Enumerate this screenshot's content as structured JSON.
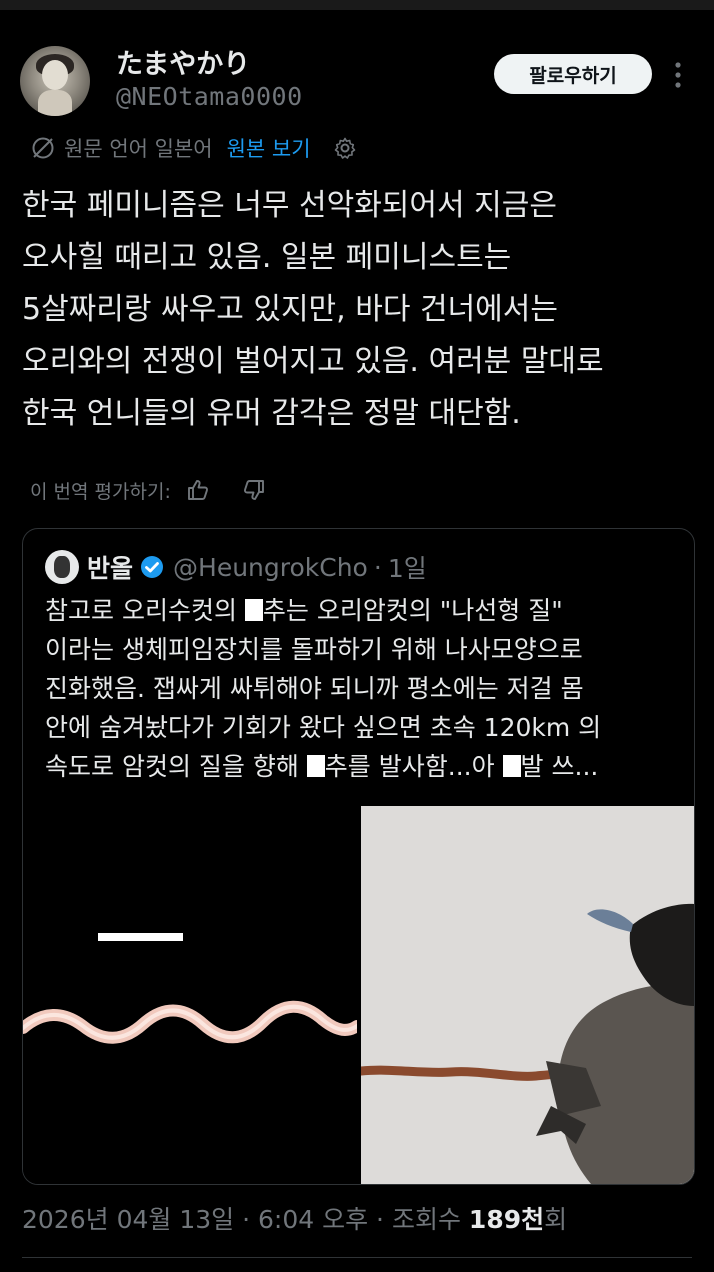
{
  "author": {
    "display_name": "たまやかり",
    "handle": "@NEOtama0000"
  },
  "actions": {
    "follow_label": "팔로우하기",
    "more_icon": "more-vertical-icon"
  },
  "translation": {
    "original_language_label": "원문 언어 일본어",
    "view_original_label": "원본 보기",
    "rate_label": "이 번역 평가하기:"
  },
  "tweet": {
    "text": "한국 페미니즘은 너무 선악화되어서 지금은\n오사힐 때리고 있음. 일본 페미니스트는\n5살짜리랑 싸우고 있지만, 바다 건너에서는\n오리와의 전쟁이 벌어지고 있음. 여러분 말대로\n한국 언니들의 유머 감각은 정말 대단함."
  },
  "quote": {
    "name": "반올",
    "handle": "@HeungrokCho",
    "separator": "·",
    "time": "1일",
    "text_line1_a": "참고로 오리수컷의 ",
    "text_line1_b": "추는 오리암컷의 \"나선형 질\"",
    "text_line2": "이라는 생체피임장치를 돌파하기 위해 나사모양으로",
    "text_line3": "진화했음. 잽싸게 싸튀해야 되니까 평소에는 저걸 몸",
    "text_line4": "안에 숨겨놨다가 기회가 왔다 싶으면 초속 120km 의",
    "text_line5_a": "속도로 암컷의 질을 향해 ",
    "text_line5_b": "추를 발사함...아 ",
    "text_line5_c": "발 쓰..."
  },
  "stats": {
    "date": "2026년 04월 13일",
    "separator": "·",
    "time": "6:04 오후",
    "views_label": "조회수",
    "views_count": "189천",
    "views_suffix": "회"
  },
  "colors": {
    "background": "#000000",
    "text": "#e7e9ea",
    "secondary": "#71767b",
    "accent": "#1d9bf0",
    "follow_bg": "#eff3f4"
  }
}
